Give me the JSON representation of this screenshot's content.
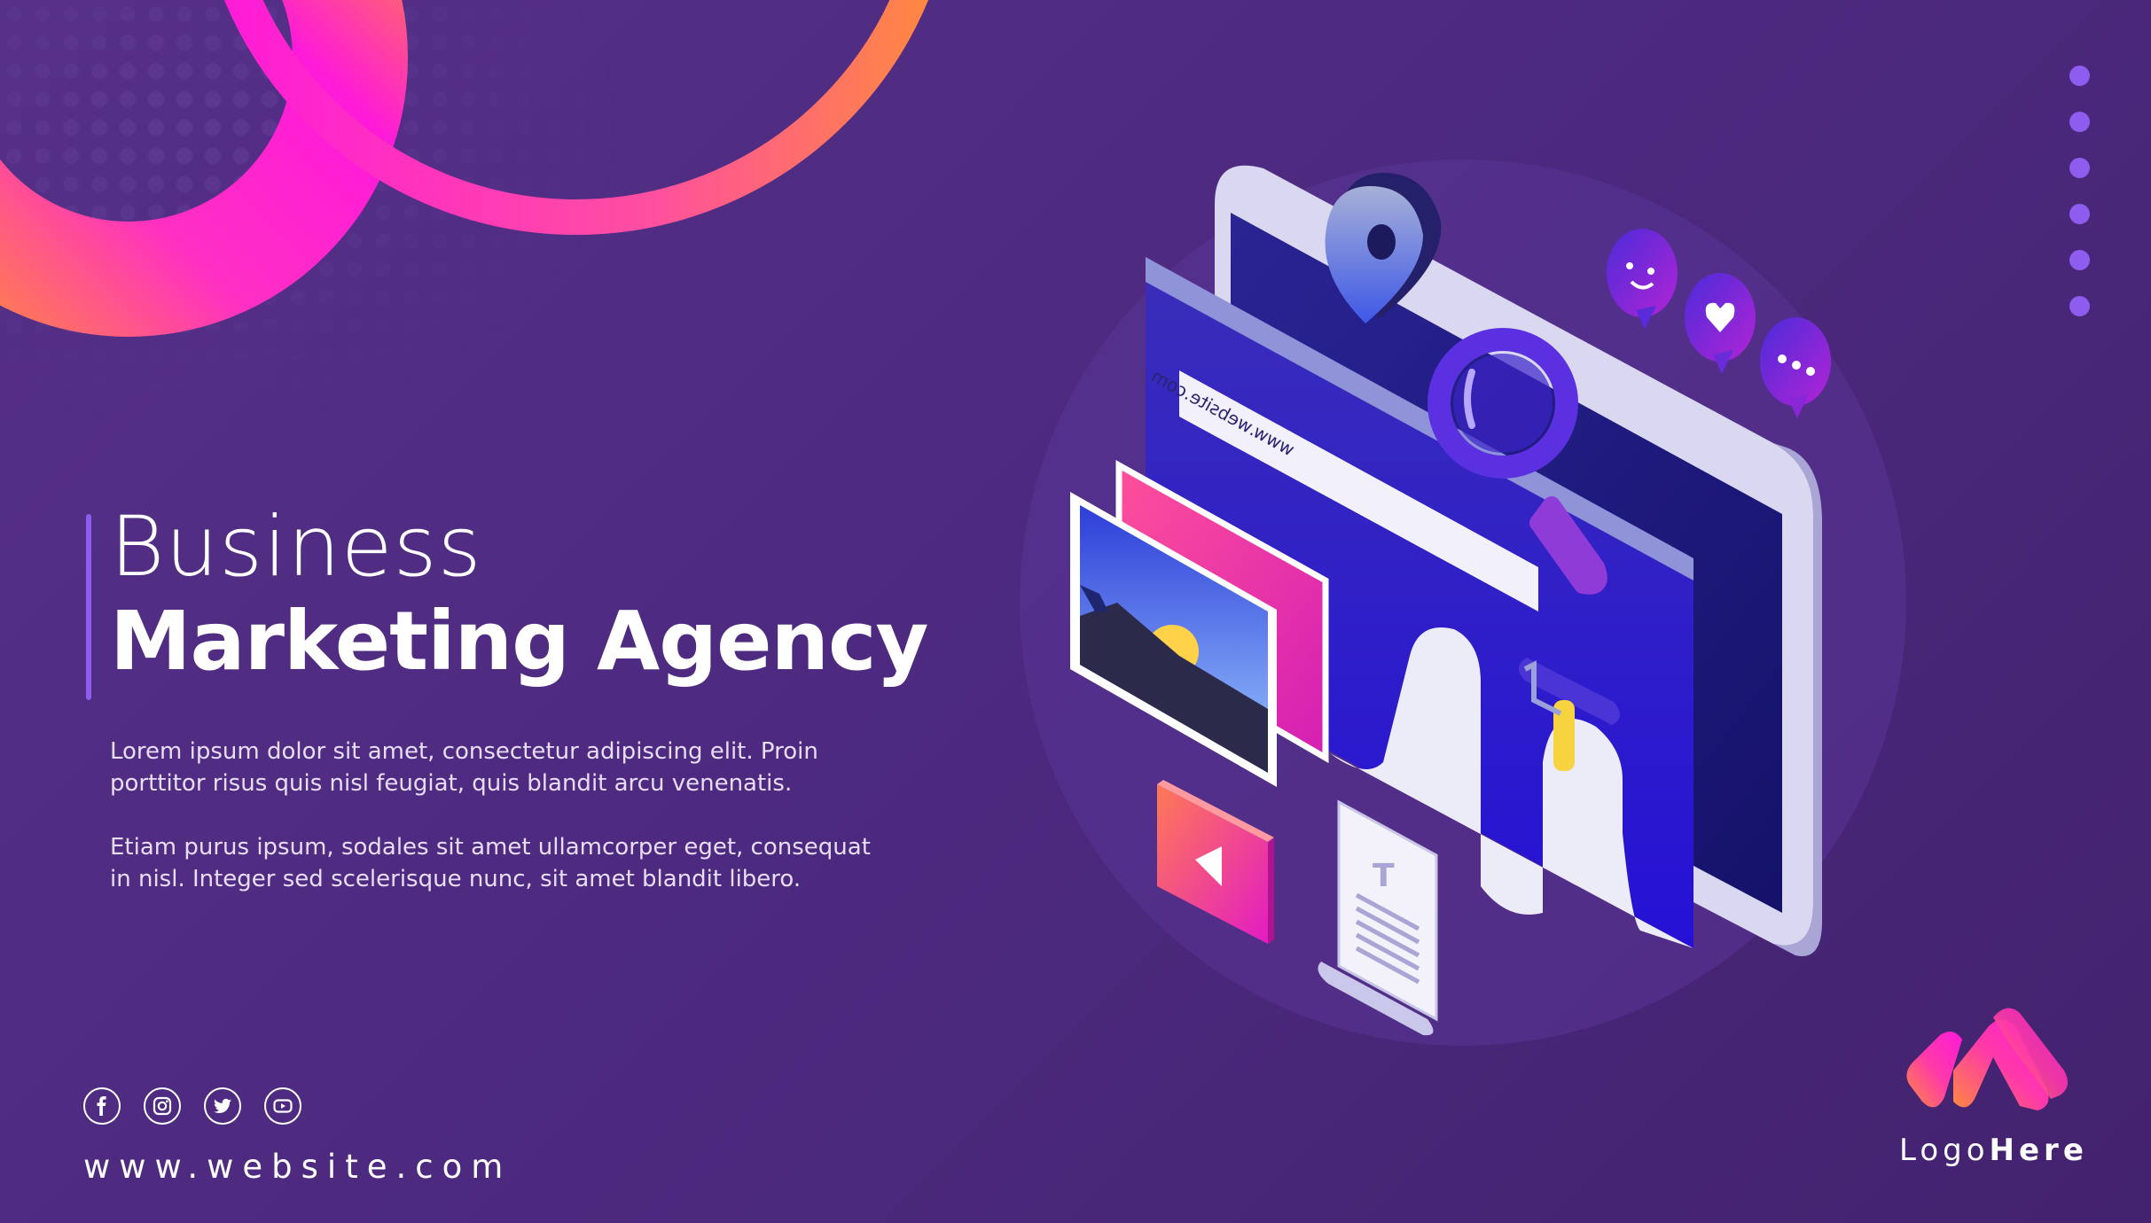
{
  "colors": {
    "background_start": "#563087",
    "background_end": "#43226f",
    "accent_purple": "#8f5cf0",
    "gradient_pink": "#ff1ad9",
    "gradient_orange": "#ff8a3d",
    "screen_blue": "#2e18c8",
    "text_white": "#ffffff"
  },
  "headline": {
    "line1": "Business",
    "line2": "Marketing Agency"
  },
  "body": {
    "paragraph1": "Lorem ipsum dolor sit amet, consectetur adipiscing elit. Proin porttitor risus quis nisl feugiat, quis blandit arcu venenatis.",
    "paragraph2": "Etiam purus ipsum, sodales sit amet ullamcorper eget, consequat in nisl. Integer sed scelerisque nunc, sit amet blandit libero."
  },
  "illustration": {
    "url_bar_text": "www.website.com",
    "document_letter": "T",
    "icons": [
      "location-pin-icon",
      "magnifier-icon",
      "paint-roller-icon",
      "image-frame-icon",
      "play-icon",
      "document-icon",
      "chat-smile-icon",
      "chat-heart-icon",
      "chat-dots-icon"
    ]
  },
  "socials": [
    "facebook-icon",
    "instagram-icon",
    "twitter-icon",
    "youtube-icon"
  ],
  "footer": {
    "website": "www.website.com"
  },
  "logo": {
    "text_light": "Logo",
    "text_bold": "Here"
  }
}
